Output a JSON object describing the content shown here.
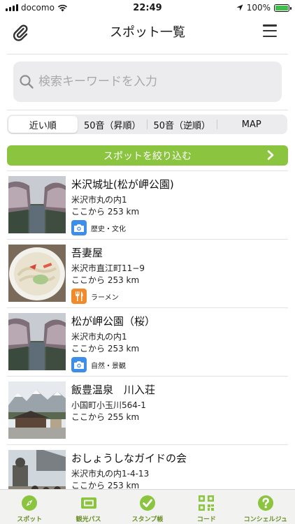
{
  "status": {
    "carrier": "docomo",
    "time": "22:49",
    "battery": "100%"
  },
  "navbar": {
    "title": "スポット一覧"
  },
  "search": {
    "placeholder": "検索キーワードを入力"
  },
  "sort_tabs": [
    {
      "label": "近い順",
      "active": true
    },
    {
      "label": "50音（昇順）",
      "active": false
    },
    {
      "label": "50音（逆順）",
      "active": false
    },
    {
      "label": "MAP",
      "active": false
    }
  ],
  "filter": {
    "label": "スポットを絞り込む"
  },
  "spots": [
    {
      "name": "米沢城址(松が岬公園)",
      "address": "米沢市丸の内1",
      "distance": "ここから 253 km",
      "category": "歴史・文化",
      "category_icon": "camera-icon",
      "category_color": "#3d8ee8"
    },
    {
      "name": "吾妻屋",
      "address": "米沢市直江町11−9",
      "distance": "ここから 253 km",
      "category": "ラーメン",
      "category_icon": "fork-knife-icon",
      "category_color": "#f08a2b"
    },
    {
      "name": "松が岬公園（桜）",
      "address": "米沢市丸の内1",
      "distance": "ここから 253 km",
      "category": "自然・景観",
      "category_icon": "camera-icon",
      "category_color": "#3d8ee8"
    },
    {
      "name": "飯豊温泉　川入荘",
      "address": "小国町小玉川564-1",
      "distance": "ここから 255 km",
      "category": "",
      "category_icon": "",
      "category_color": ""
    },
    {
      "name": "おしょうしなガイドの会",
      "address": "米沢市丸の内1-4-13",
      "distance": "ここから 253 km",
      "category": "",
      "category_icon": "",
      "category_color": ""
    }
  ],
  "tabbar": [
    {
      "label": "スポット",
      "icon": "compass-icon"
    },
    {
      "label": "観光パス",
      "icon": "ticket-icon"
    },
    {
      "label": "スタンプ帳",
      "icon": "check-circle-icon"
    },
    {
      "label": "コード",
      "icon": "qr-code-icon"
    },
    {
      "label": "コンシェルジュ",
      "icon": "help-circle-icon"
    }
  ],
  "colors": {
    "accent": "#8bc53f",
    "tab_label": "#6b8f2a"
  }
}
